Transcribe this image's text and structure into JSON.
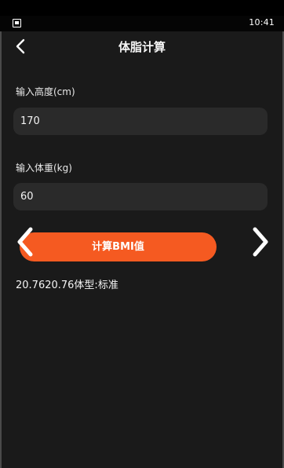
{
  "status_bar": {
    "time": "10:41",
    "left_icon": "notification-box-icon"
  },
  "header": {
    "title": "体脂计算",
    "back_icon": "chevron-left-icon"
  },
  "form": {
    "height_label": "输入高度(cm)",
    "height_value": "170",
    "weight_label": "输入体重(kg)",
    "weight_value": "60"
  },
  "action": {
    "calc_label": "计算BMI值",
    "accent_color": "#f55a21"
  },
  "result": {
    "text": "20.7620.76体型:标准"
  },
  "overlay": {
    "prev_icon": "chevron-left-icon",
    "next_icon": "chevron-right-icon"
  }
}
